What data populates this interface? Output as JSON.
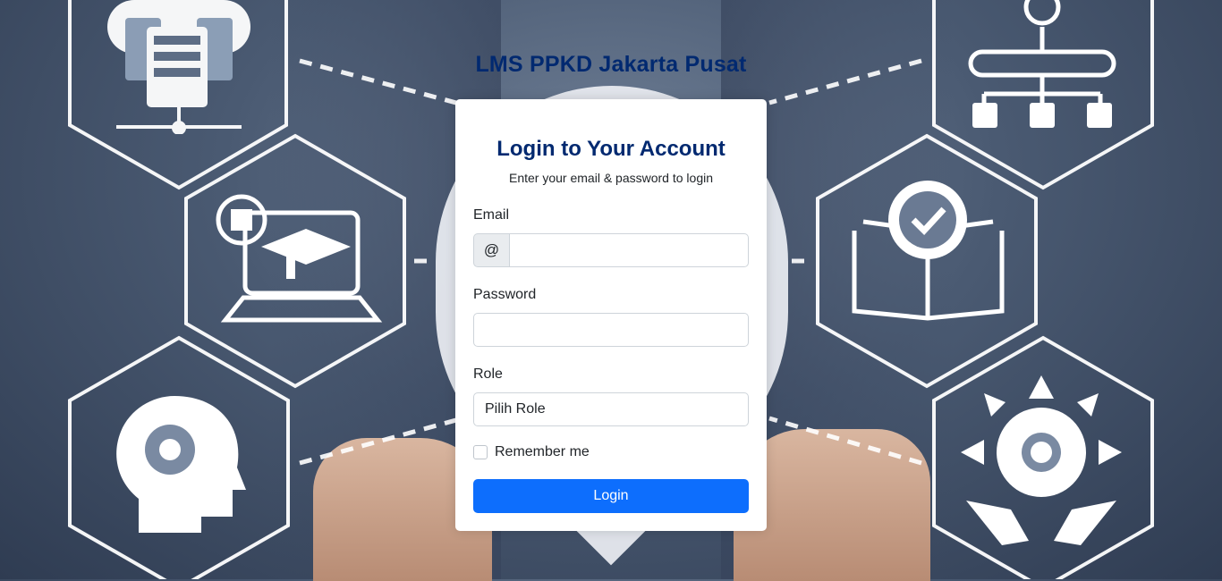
{
  "brand": {
    "title": "LMS PPKD Jakarta Pusat"
  },
  "login": {
    "title": "Login to Your Account",
    "subtitle": "Enter your email & password to login",
    "email_label": "Email",
    "email_addon": "@",
    "email_value": "",
    "password_label": "Password",
    "password_value": "",
    "role_label": "Role",
    "role_selected": "Pilih Role",
    "remember_label": "Remember me",
    "submit_label": "Login"
  },
  "background": {
    "icons": [
      "server-icon",
      "elearning-laptop-icon",
      "mind-gear-icon",
      "network-diagram-icon",
      "certified-book-icon",
      "gear-arrows-hands-icon"
    ]
  },
  "colors": {
    "brand": "#012970",
    "primary": "#0d6efd"
  }
}
